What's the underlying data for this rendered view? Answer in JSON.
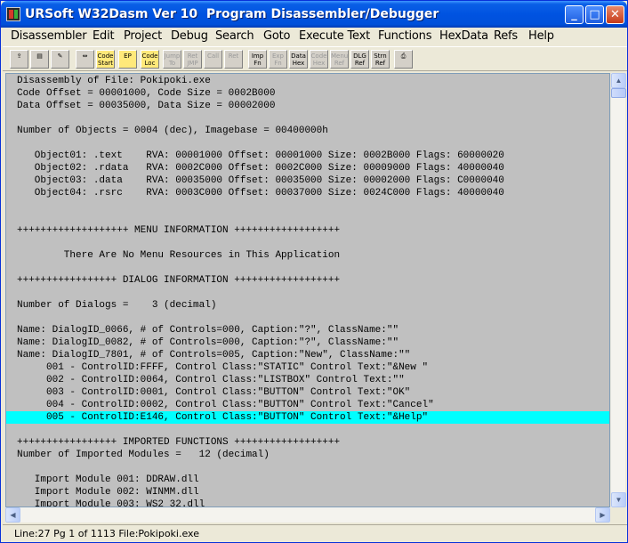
{
  "window": {
    "title": "URSoft W32Dasm Ver 10  Program Disassembler/Debugger"
  },
  "titlebar_buttons": {
    "minimize": "_",
    "maximize": "□",
    "close": "✕"
  },
  "menu": [
    "Disassembler",
    "Edit",
    "Project",
    "Debug",
    "Search",
    "Goto",
    "Execute Text",
    "Functions",
    "HexData",
    "Refs",
    "Help"
  ],
  "toolbar": [
    {
      "name": "open-file-icon",
      "label": "",
      "enabled": true
    },
    {
      "name": "save-file-icon",
      "label": "",
      "enabled": true
    },
    {
      "name": "print-icon",
      "label": "",
      "enabled": true
    },
    {
      "name": "find-icon",
      "label": "",
      "enabled": true
    },
    {
      "name": "step-icon",
      "label": "",
      "enabled": false
    },
    {
      "name": "goto-code-start-icon",
      "label": "Code Start",
      "enabled": true
    },
    {
      "name": "goto-ep-icon",
      "label": "EP",
      "enabled": true
    },
    {
      "name": "goto-code-loc-icon",
      "label": "Code Loc",
      "enabled": true
    },
    {
      "name": "jump-to-icon",
      "label": "Jump To",
      "enabled": false
    },
    {
      "name": "ret-jmp-icon",
      "label": "Ret JMP",
      "enabled": false
    },
    {
      "name": "call-icon",
      "label": "Call",
      "enabled": false
    },
    {
      "name": "ret-call-icon",
      "label": "Ret",
      "enabled": false
    },
    {
      "name": "imp-fn-icon",
      "label": "Imp Fn",
      "enabled": true
    },
    {
      "name": "exp-fn-icon",
      "label": "Exp Fn",
      "enabled": false
    },
    {
      "name": "data-hex-icon",
      "label": "Data Hex",
      "enabled": true
    },
    {
      "name": "code-hex-icon",
      "label": "Code Hex",
      "enabled": false
    },
    {
      "name": "menu-ref-icon",
      "label": "Menu Ref",
      "enabled": false
    },
    {
      "name": "dlg-ref-icon",
      "label": "DLG Ref",
      "enabled": true
    },
    {
      "name": "strn-ref-icon",
      "label": "Strn Ref",
      "enabled": true
    },
    {
      "name": "printer-icon",
      "label": "",
      "enabled": true
    }
  ],
  "listing": [
    "Disassembly of File: Pokipoki.exe",
    "Code Offset = 00001000, Code Size = 0002B000",
    "Data Offset = 00035000, Data Size = 00002000",
    "",
    "Number of Objects = 0004 (dec), Imagebase = 00400000h",
    "",
    "   Object01: .text    RVA: 00001000 Offset: 00001000 Size: 0002B000 Flags: 60000020",
    "   Object02: .rdata   RVA: 0002C000 Offset: 0002C000 Size: 00009000 Flags: 40000040",
    "   Object03: .data    RVA: 00035000 Offset: 00035000 Size: 00002000 Flags: C0000040",
    "   Object04: .rsrc    RVA: 0003C000 Offset: 00037000 Size: 0024C000 Flags: 40000040",
    "",
    "",
    "+++++++++++++++++++ MENU INFORMATION ++++++++++++++++++",
    "",
    "        There Are No Menu Resources in This Application",
    "",
    "+++++++++++++++++ DIALOG INFORMATION ++++++++++++++++++",
    "",
    "Number of Dialogs =    3 (decimal)",
    "",
    "Name: DialogID_0066, # of Controls=000, Caption:\"?\", ClassName:\"\"",
    "Name: DialogID_0082, # of Controls=000, Caption:\"?\", ClassName:\"\"",
    "Name: DialogID_7801, # of Controls=005, Caption:\"New\", ClassName:\"\"",
    "     001 - ControlID:FFFF, Control Class:\"STATIC\" Control Text:\"&New \"",
    "     002 - ControlID:0064, Control Class:\"LISTBOX\" Control Text:\"\"",
    "     003 - ControlID:0001, Control Class:\"BUTTON\" Control Text:\"OK\"",
    "     004 - ControlID:0002, Control Class:\"BUTTON\" Control Text:\"Cancel\"",
    "     005 - ControlID:E146, Control Class:\"BUTTON\" Control Text:\"&Help\"",
    "",
    "+++++++++++++++++ IMPORTED FUNCTIONS ++++++++++++++++++",
    "Number of Imported Modules =   12 (decimal)",
    "",
    "   Import Module 001: DDRAW.dll",
    "   Import Module 002: WINMM.dll",
    "   Import Module 003: WS2_32.dll"
  ],
  "selected_line_index": 27,
  "colors": {
    "selection": "#00FFFF",
    "text_background": "#C0C0C0",
    "titlebar": "#0053E1"
  },
  "status": {
    "text": "Line:27 Pg 1 of 1113 File:Pokipoki.exe"
  },
  "scrollbar": {
    "up": "▲",
    "down": "▼",
    "left": "◀",
    "right": "▶"
  }
}
